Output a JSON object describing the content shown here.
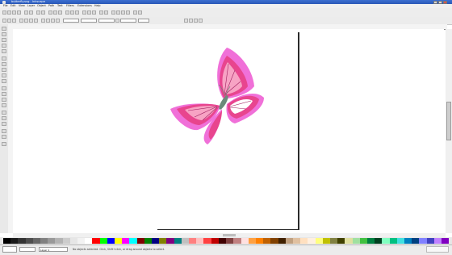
{
  "window": {
    "title": "butterfly.svg - Inkscape"
  },
  "menubar": {
    "items": [
      "File",
      "Edit",
      "View",
      "Layer",
      "Object",
      "Path",
      "Text",
      "Filters",
      "Extensions",
      "Help"
    ]
  },
  "canvas": {
    "artwork": "butterfly",
    "colors": {
      "outer_wing": "#f070d8",
      "wing_main": "#e8458e",
      "wing_light": "#ffffff",
      "wing_pink": "#f7a3c4",
      "body": "#6b8a7a",
      "veins": "#a02060"
    }
  },
  "palette": {
    "colors": [
      "#000000",
      "#1a1a1a",
      "#333333",
      "#4d4d4d",
      "#666666",
      "#808080",
      "#999999",
      "#b3b3b3",
      "#cccccc",
      "#e6e6e6",
      "#f2f2f2",
      "#ffffff",
      "#ff0000",
      "#00ff00",
      "#0000ff",
      "#ffff00",
      "#ff00ff",
      "#00ffff",
      "#800000",
      "#008000",
      "#000080",
      "#808000",
      "#800080",
      "#008080",
      "#c0c0c0",
      "#ff8080",
      "#ffc0c0",
      "#ff4040",
      "#c00000",
      "#400000",
      "#804040",
      "#c08080",
      "#ffe0e0",
      "#ffa040",
      "#ff8000",
      "#c06000",
      "#804000",
      "#402000",
      "#c0a080",
      "#e0c0a0",
      "#ffe0c0",
      "#fff0e0",
      "#ffff80",
      "#c0c000",
      "#808040",
      "#404000",
      "#e0e0a0",
      "#a0e0a0",
      "#40c040",
      "#008040",
      "#004020",
      "#80ffc0",
      "#00c080",
      "#40e0e0",
      "#0080c0",
      "#004080",
      "#8080ff",
      "#4040c0",
      "#c080ff",
      "#8000c0"
    ]
  },
  "statusbar": {
    "layer": "Layer 1",
    "message": "No objects selected. Click, Shift+click, or drag around objects to select."
  }
}
